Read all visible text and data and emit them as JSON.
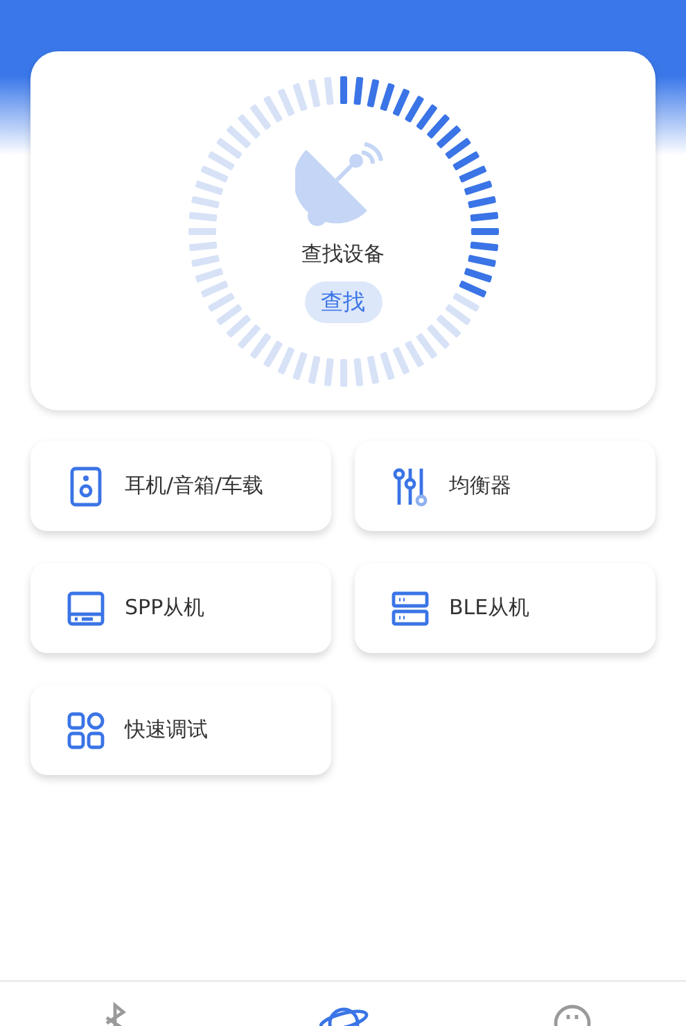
{
  "scan": {
    "title": "查找设备",
    "button": "查找"
  },
  "tiles": [
    {
      "kind": "speaker",
      "label": "耳机/音箱/车载"
    },
    {
      "kind": "equalizer",
      "label": "均衡器"
    },
    {
      "kind": "drive",
      "label": "SPP从机"
    },
    {
      "kind": "server",
      "label": "BLE从机"
    },
    {
      "kind": "grid",
      "label": "快速调试"
    }
  ],
  "bottom_nav": [
    {
      "kind": "bluetooth",
      "selected": false
    },
    {
      "kind": "planet",
      "selected": true
    },
    {
      "kind": "face",
      "selected": false
    }
  ]
}
